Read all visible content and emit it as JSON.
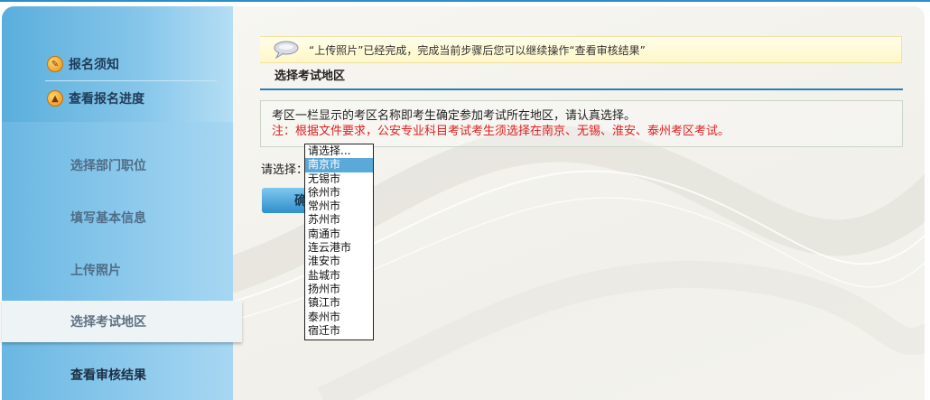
{
  "sidebar": {
    "links": [
      {
        "label": "报名须知",
        "icon": "info-icon"
      },
      {
        "label": "查看报名进度",
        "icon": "progress-icon"
      }
    ],
    "steps": [
      {
        "label": "选择部门职位"
      },
      {
        "label": "填写基本信息"
      },
      {
        "label": "上传照片"
      },
      {
        "label": "选择考试地区"
      },
      {
        "label": "查看审核结果"
      }
    ]
  },
  "notice": {
    "text": "“上传照片”已经完成，完成当前步骤后您可以继续操作“查看审核结果”"
  },
  "section": {
    "title": "选择考试地区"
  },
  "info": {
    "line1": "考区一栏显示的考区名称即考生确定参加考试所在地区，请认真选择。",
    "line2": "注：根据文件要求，公安专业科目考试考生须选择在南京、无锡、淮安、泰州考区考试。"
  },
  "select": {
    "label": "请选择：",
    "options": [
      "请选择...",
      "南京市",
      "无锡市",
      "徐州市",
      "常州市",
      "苏州市",
      "南通市",
      "连云港市",
      "淮安市",
      "盐城市",
      "扬州市",
      "镇江市",
      "泰州市",
      "宿迁市"
    ],
    "highlighted_index": 1
  },
  "confirm_button": {
    "label": "确"
  }
}
